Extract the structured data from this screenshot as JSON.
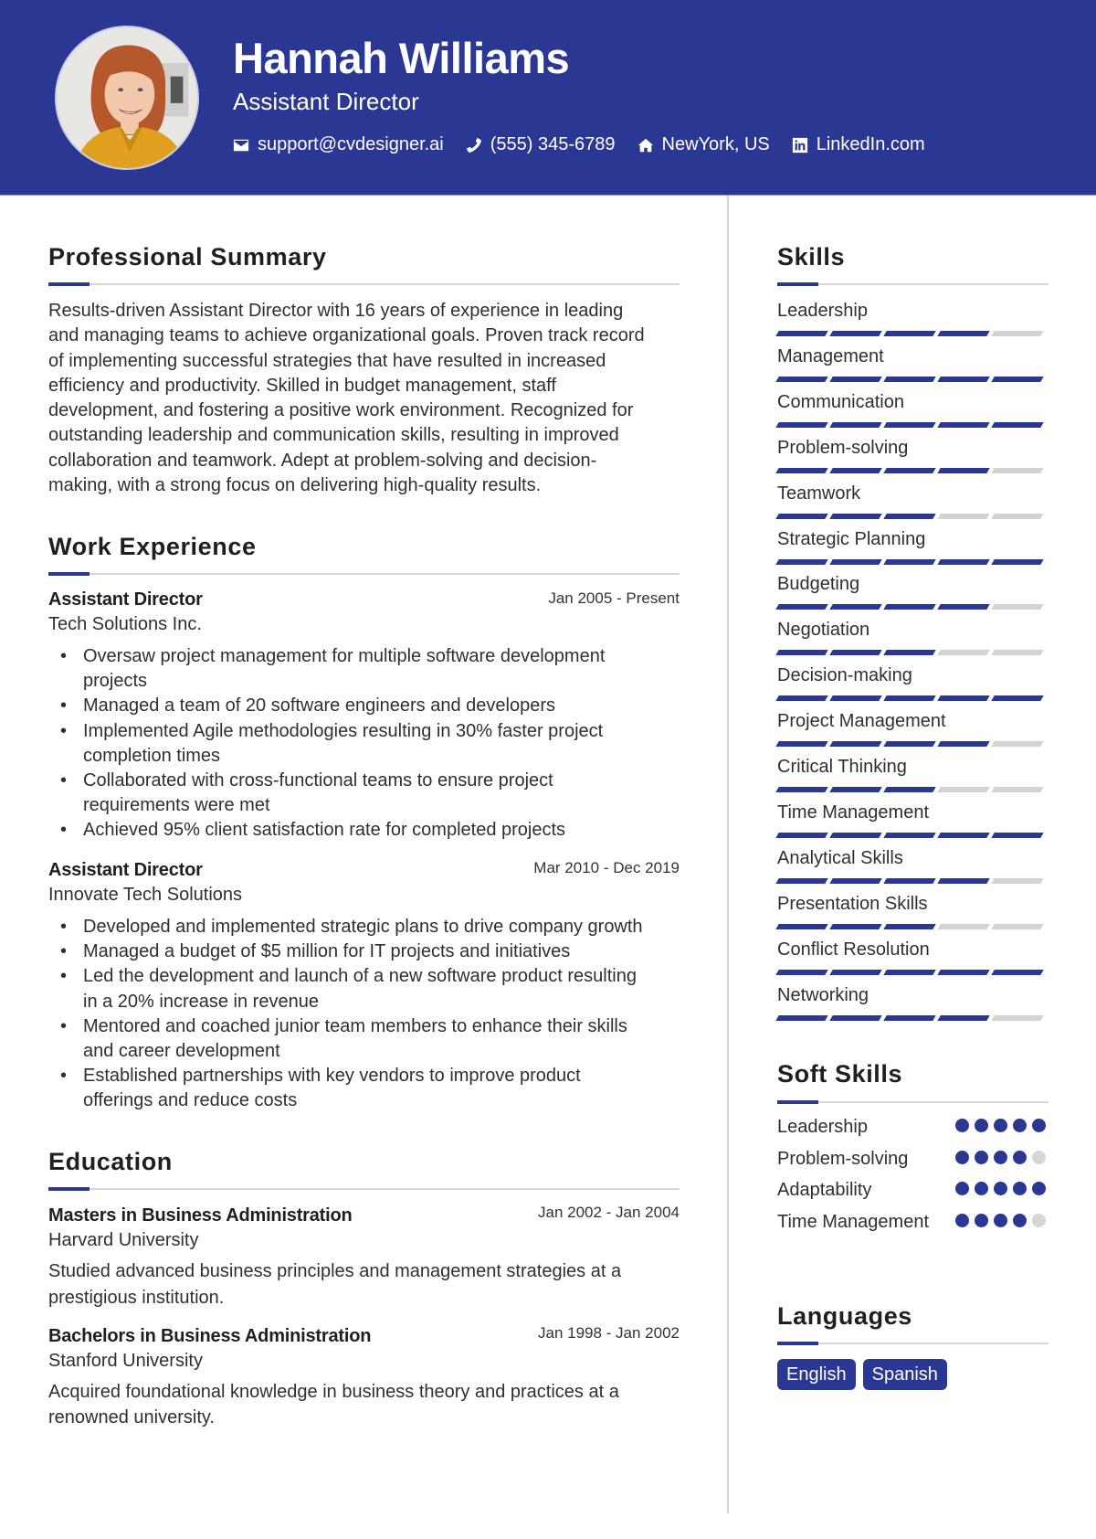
{
  "header": {
    "name": "Hannah Williams",
    "title": "Assistant Director",
    "contacts": [
      {
        "icon": "envelope-icon",
        "text": "support@cvdesigner.ai"
      },
      {
        "icon": "phone-icon",
        "text": "(555) 345-6789"
      },
      {
        "icon": "home-icon",
        "text": "NewYork, US"
      },
      {
        "icon": "linkedin-icon",
        "text": "LinkedIn.com"
      }
    ]
  },
  "colors": {
    "accent": "#2a3893",
    "track": "#d3d3d3",
    "text": "#2f2f2f"
  },
  "summary": {
    "heading": "Professional Summary",
    "lines": [
      "Results-driven Assistant Director with 16 years of experience in leading",
      "and managing teams to achieve organizational goals. Proven track record",
      "of implementing successful strategies that have resulted in increased",
      "efficiency and productivity. Skilled in budget management, staff",
      "development, and fostering a positive work environment. Recognized for",
      "outstanding leadership and communication skills, resulting in improved",
      "collaboration and teamwork. Adept at problem-solving and decision-",
      "making, with a strong focus on delivering high-quality results."
    ]
  },
  "experience": {
    "heading": "Work Experience",
    "jobs": [
      {
        "title": "Assistant Director",
        "date": "Jan 2005 - Present",
        "company": "Tech Solutions Inc.",
        "bullets": [
          [
            "Oversaw project management for multiple software development",
            "projects"
          ],
          [
            "Managed a team of 20 software engineers and developers"
          ],
          [
            "Implemented Agile methodologies resulting in 30% faster project",
            "completion times"
          ],
          [
            "Collaborated with cross-functional teams to ensure project",
            "requirements were met"
          ],
          [
            "Achieved 95% client satisfaction rate for completed projects"
          ]
        ]
      },
      {
        "title": "Assistant Director",
        "date": "Mar 2010 - Dec 2019",
        "company": "Innovate Tech Solutions",
        "bullets": [
          [
            "Developed and implemented strategic plans to drive company growth"
          ],
          [
            "Managed a budget of $5 million for IT projects and initiatives"
          ],
          [
            "Led the development and launch of a new software product resulting",
            "in a 20% increase in revenue"
          ],
          [
            "Mentored and coached junior team members to enhance their skills",
            "and career development"
          ],
          [
            "Established partnerships with key vendors to improve product",
            "offerings and reduce costs"
          ]
        ]
      }
    ]
  },
  "education": {
    "heading": "Education",
    "items": [
      {
        "degree": "Masters in Business Administration",
        "date": "Jan 2002 - Jan 2004",
        "school": "Harvard University",
        "desc": [
          "Studied advanced business principles and management strategies at a",
          "prestigious institution."
        ]
      },
      {
        "degree": "Bachelors in Business Administration",
        "date": "Jan 1998 - Jan 2002",
        "school": "Stanford University",
        "desc": [
          "Acquired foundational knowledge in business theory and practices at a",
          "renowned university."
        ]
      }
    ]
  },
  "skills": {
    "heading": "Skills",
    "max_level": 5,
    "items": [
      {
        "name": "Leadership",
        "level": 4
      },
      {
        "name": "Management",
        "level": 5
      },
      {
        "name": "Communication",
        "level": 5
      },
      {
        "name": "Problem-solving",
        "level": 4
      },
      {
        "name": "Teamwork",
        "level": 3
      },
      {
        "name": "Strategic Planning",
        "level": 5
      },
      {
        "name": "Budgeting",
        "level": 4
      },
      {
        "name": "Negotiation",
        "level": 3
      },
      {
        "name": "Decision-making",
        "level": 5
      },
      {
        "name": "Project Management",
        "level": 4
      },
      {
        "name": "Critical Thinking",
        "level": 3
      },
      {
        "name": "Time Management",
        "level": 5
      },
      {
        "name": "Analytical Skills",
        "level": 4
      },
      {
        "name": "Presentation Skills",
        "level": 3
      },
      {
        "name": "Conflict Resolution",
        "level": 5
      },
      {
        "name": "Networking",
        "level": 4
      }
    ]
  },
  "soft_skills": {
    "heading": "Soft Skills",
    "max_level": 5,
    "items": [
      {
        "name": "Leadership",
        "level": 5
      },
      {
        "name": "Problem-solving",
        "level": 4
      },
      {
        "name": "Adaptability",
        "level": 5
      },
      {
        "name": "Time Management",
        "level": 4
      }
    ]
  },
  "languages": {
    "heading": "Languages",
    "items": [
      "English",
      "Spanish"
    ]
  }
}
